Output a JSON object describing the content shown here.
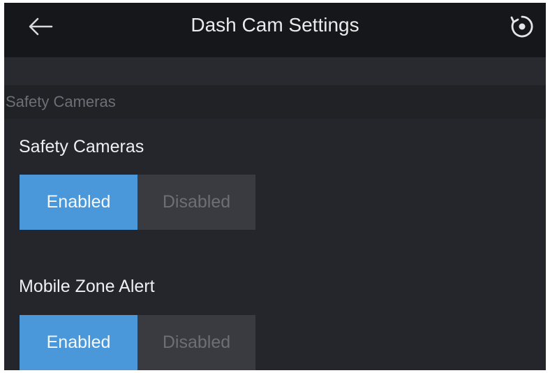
{
  "header": {
    "title": "Dash Cam Settings",
    "back_icon": "arrow-left-icon",
    "reset_icon": "circular-reset-icon"
  },
  "section": {
    "title": "Safety Cameras"
  },
  "settings": [
    {
      "label": "Safety Cameras",
      "options": [
        "Enabled",
        "Disabled"
      ],
      "selected": "Enabled"
    },
    {
      "label": "Mobile Zone Alert",
      "options": [
        "Enabled",
        "Disabled"
      ],
      "selected": "Enabled"
    }
  ],
  "colors": {
    "accent": "#4a98d9",
    "background": "#24262b",
    "header": "#16171a",
    "inactive_option": "#393b40"
  }
}
